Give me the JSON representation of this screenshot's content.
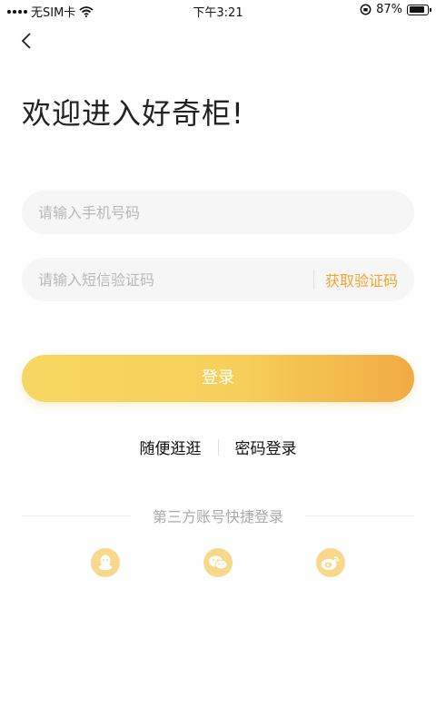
{
  "status_bar": {
    "carrier": "无SIM卡",
    "time": "下午3:21",
    "battery": "87%",
    "battery_level": 0.87
  },
  "header": {
    "welcome": "欢迎进入好奇柜!"
  },
  "form": {
    "phone_placeholder": "请输入手机号码",
    "code_placeholder": "请输入短信验证码",
    "get_code_label": "获取验证码",
    "login_label": "登录"
  },
  "links": {
    "browse": "随便逛逛",
    "password_login": "密码登录"
  },
  "third_party": {
    "title": "第三方账号快捷登录",
    "icons": [
      "qq-icon",
      "wechat-icon",
      "weibo-icon"
    ]
  },
  "colors": {
    "accent": "#f0a52f",
    "social_bg": "#f8d98c"
  }
}
